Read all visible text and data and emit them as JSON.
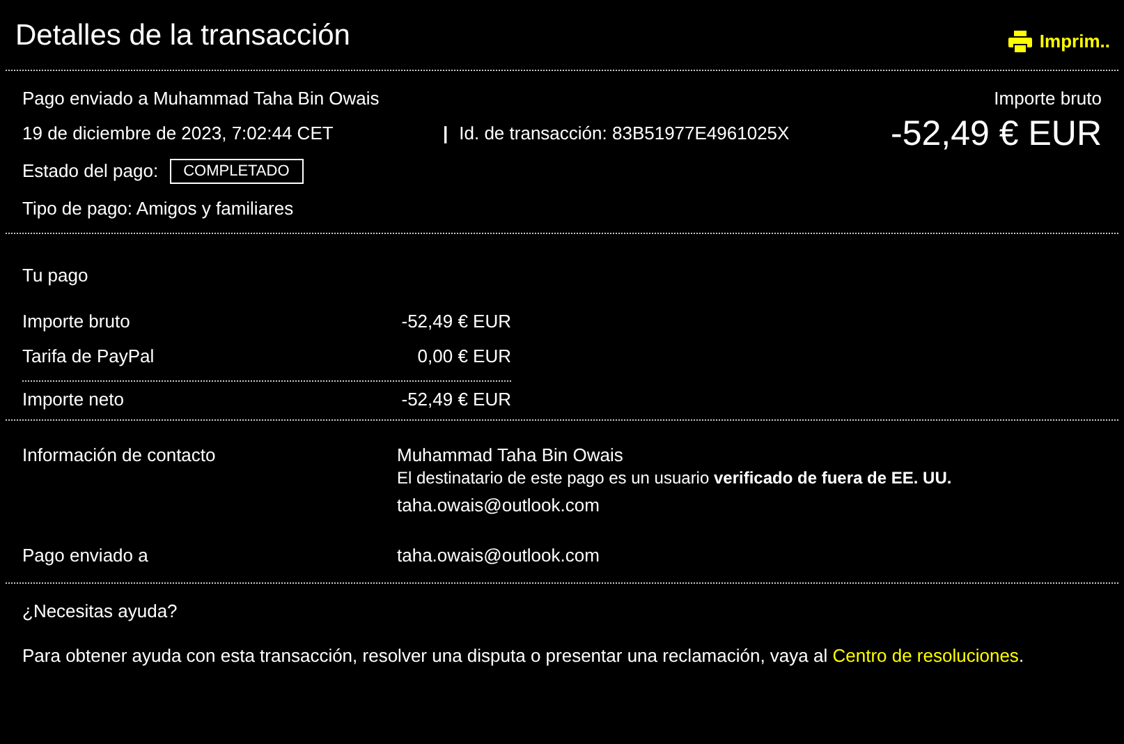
{
  "header": {
    "title": "Detalles de la transacción",
    "print_label": "Imprim.."
  },
  "summary": {
    "sent_to": "Pago enviado a Muhammad Taha Bin Owais",
    "date": "19 de diciembre de 2023, 7:02:44 CET",
    "separator": "|",
    "transaction_id": "Id. de transacción: 83B51977E4961025X",
    "status_label": "Estado del pago:",
    "status_badge": "COMPLETADO",
    "payment_type": "Tipo de pago: Amigos y familiares",
    "gross_label": "Importe bruto",
    "gross_amount": "-52,49 € EUR"
  },
  "your_payment": {
    "heading": "Tu pago",
    "rows": [
      {
        "label": "Importe bruto",
        "value": "-52,49 € EUR",
        "total": false
      },
      {
        "label": "Tarifa de PayPal",
        "value": "0,00 € EUR",
        "total": false
      },
      {
        "label": "Importe neto",
        "value": "-52,49 € EUR",
        "total": true
      }
    ]
  },
  "contact": {
    "label": "Información de contacto",
    "name": "Muhammad Taha Bin Owais",
    "note": "El destinatario de este pago es un usuario **verificado de fuera de EE. UU.**",
    "email": "taha.owais@outlook.com"
  },
  "sent_to": {
    "label": "Pago enviado a",
    "email": "taha.owais@outlook.com"
  },
  "help": {
    "heading": "¿Necesitas ayuda?",
    "text": "Para obtener ayuda con esta transacción, resolver una disputa o presentar una reclamación, vaya al",
    "link": "Centro de resoluciones",
    "end": "."
  }
}
